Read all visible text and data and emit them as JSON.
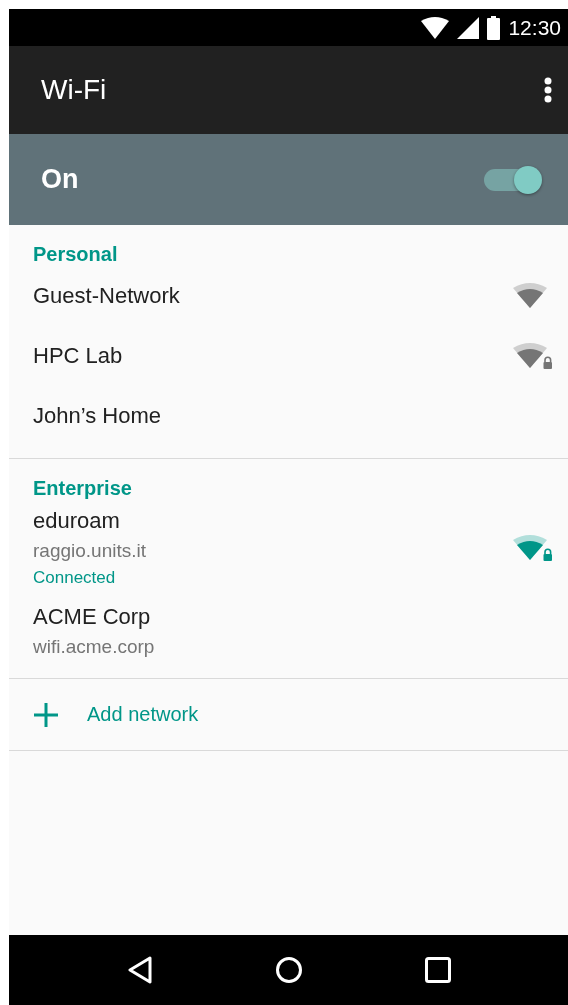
{
  "status_bar": {
    "time": "12:30"
  },
  "app_bar": {
    "title": "Wi-Fi"
  },
  "master_switch": {
    "label": "On",
    "on": true
  },
  "sections": [
    {
      "title": "Personal",
      "networks": [
        {
          "name": "Guest-Network",
          "in_range": true,
          "secured": false,
          "connected": false
        },
        {
          "name": "HPC Lab",
          "in_range": true,
          "secured": true,
          "connected": false
        },
        {
          "name": "John’s Home",
          "in_range": false
        }
      ]
    },
    {
      "title": "Enterprise",
      "networks": [
        {
          "name": "eduroam",
          "detail": "raggio.units.it",
          "status": "Connected",
          "in_range": true,
          "secured": true,
          "connected": true
        },
        {
          "name": "ACME Corp",
          "detail": "wifi.acme.corp",
          "in_range": false
        }
      ]
    }
  ],
  "add_network": {
    "label": "Add network"
  }
}
